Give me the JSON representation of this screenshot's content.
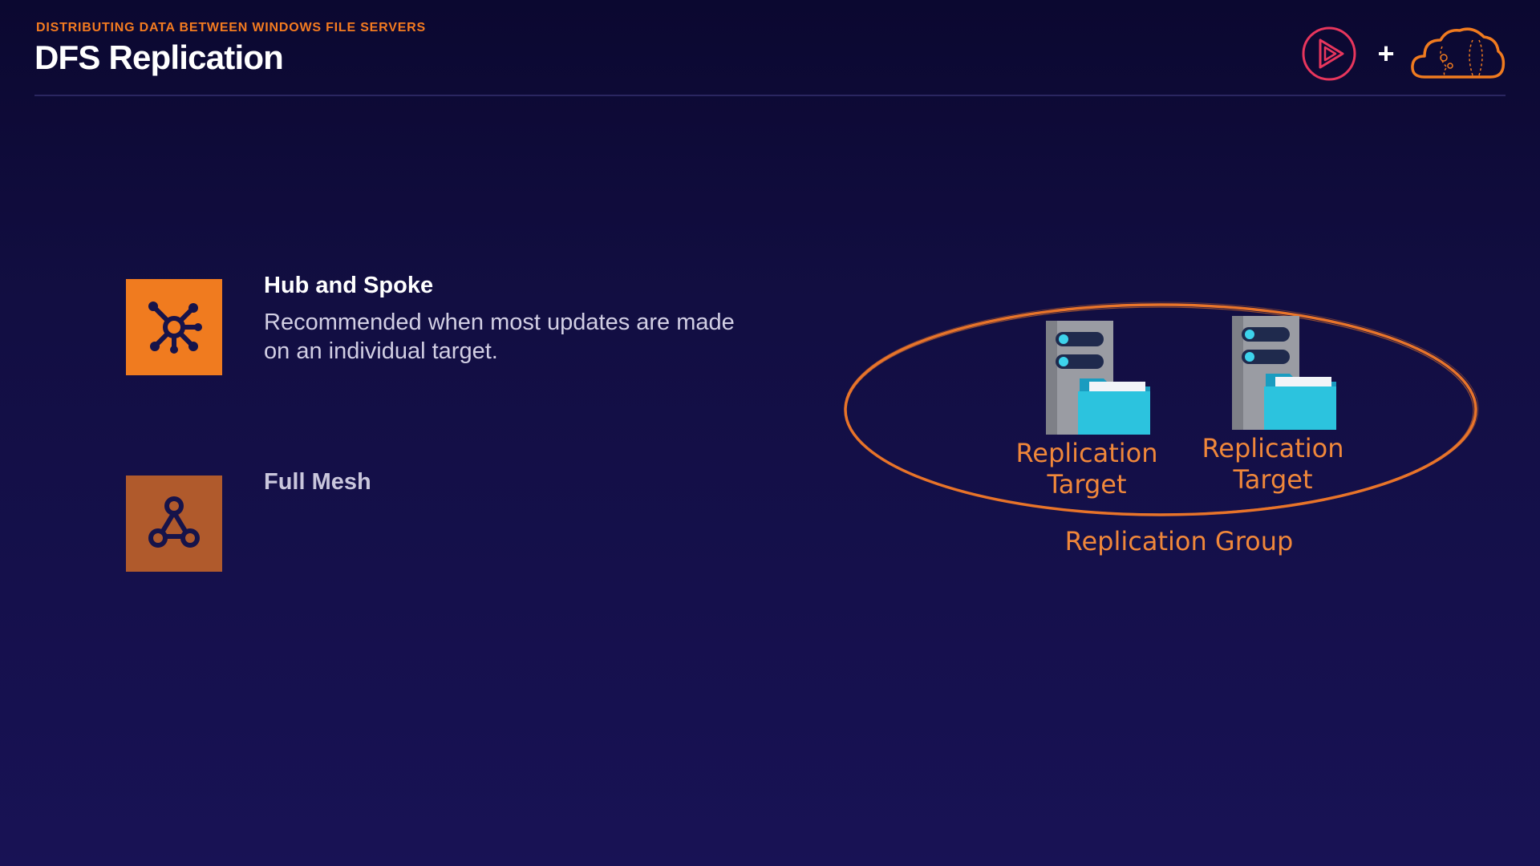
{
  "header": {
    "kicker": "DISTRIBUTING DATA BETWEEN WINDOWS FILE SERVERS",
    "title": "DFS Replication",
    "plus": "+"
  },
  "options": [
    {
      "title": "Hub and Spoke",
      "description": "Recommended when most updates are made on an individual target.",
      "icon": "hub-spoke-icon"
    },
    {
      "title": "Full Mesh",
      "icon": "mesh-triangle-icon"
    }
  ],
  "diagram": {
    "targets": [
      {
        "label_line1": "Replication",
        "label_line2": "Target"
      },
      {
        "label_line1": "Replication",
        "label_line2": "Target"
      }
    ],
    "group_label": "Replication Group"
  },
  "colors": {
    "accent": "#f07b1f",
    "mesh_tile": "#b05a2c",
    "folder": "#2cc3de",
    "server": "#9a9ca3"
  }
}
